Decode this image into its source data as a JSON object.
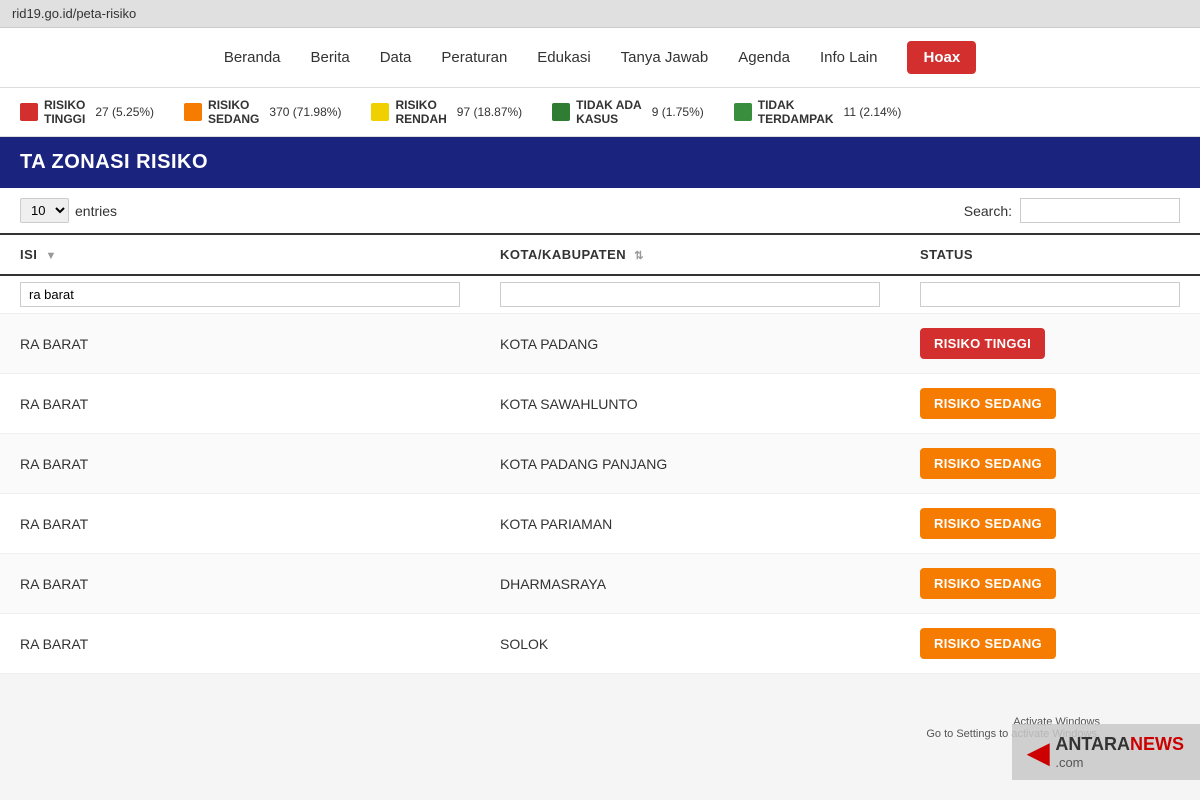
{
  "browser": {
    "url": "rid19.go.id/peta-risiko"
  },
  "nav": {
    "items": [
      "Beranda",
      "Berita",
      "Data",
      "Peraturan",
      "Edukasi",
      "Tanya Jawab",
      "Agenda",
      "Info Lain"
    ],
    "hoax_label": "Hoax"
  },
  "legend": [
    {
      "id": "tinggi",
      "label": "RISIKO TINGGI",
      "color": "#d32f2f",
      "count": "27 (5.25%)"
    },
    {
      "id": "sedang",
      "label": "RISIKO SEDANG",
      "color": "#f57c00",
      "count": "370 (71.98%)"
    },
    {
      "id": "rendah",
      "label": "RISIKO RENDAH",
      "color": "#f9c107",
      "count": "97 (18.87%)"
    },
    {
      "id": "tidak-ada",
      "label": "TIDAK ADA KASUS",
      "color": "#2e7d32",
      "count": "9 (1.75%)"
    },
    {
      "id": "tidak-terdampak",
      "label": "TIDAK TERDAMPAK",
      "color": "#388e3c",
      "count": "11 (2.14%)"
    }
  ],
  "section_title": "TA ZONASI RISIKO",
  "table_controls": {
    "entries_label": "entries",
    "search_label": "Search:",
    "search_placeholder": ""
  },
  "table": {
    "columns": [
      {
        "key": "provinsi",
        "label": "ISI",
        "sortable": true
      },
      {
        "key": "kota",
        "label": "KOTA/KABUPATEN",
        "sortable": true
      },
      {
        "key": "status",
        "label": "STATUS",
        "sortable": false
      }
    ],
    "filter_values": {
      "provinsi": "ra barat",
      "kota": "",
      "status": ""
    },
    "rows": [
      {
        "provinsi": "RA BARAT",
        "kota": "KOTA PADANG",
        "status": "RISIKO TINGGI",
        "status_class": "badge-tinggi"
      },
      {
        "provinsi": "RA BARAT",
        "kota": "KOTA SAWAHLUNTO",
        "status": "RISIKO SEDANG",
        "status_class": "badge-sedang"
      },
      {
        "provinsi": "RA BARAT",
        "kota": "KOTA PADANG PANJANG",
        "status": "RISIKO SEDANG",
        "status_class": "badge-sedang"
      },
      {
        "provinsi": "RA BARAT",
        "kota": "KOTA PARIAMAN",
        "status": "RISIKO SEDANG",
        "status_class": "badge-sedang"
      },
      {
        "provinsi": "RA BARAT",
        "kota": "DHARMASRAYA",
        "status": "RISIKO SEDANG",
        "status_class": "badge-sedang"
      },
      {
        "provinsi": "RA BARAT",
        "kota": "SOLOK",
        "status": "RISIKO SEDANG",
        "status_class": "badge-sedang"
      }
    ]
  },
  "watermark": {
    "logo": "◀",
    "name": "ANTARA",
    "suffix": "NEWS",
    "domain": ".com"
  },
  "activate_windows": {
    "line1": "Activate Windows",
    "line2": "Go to Settings to activate Windows."
  }
}
